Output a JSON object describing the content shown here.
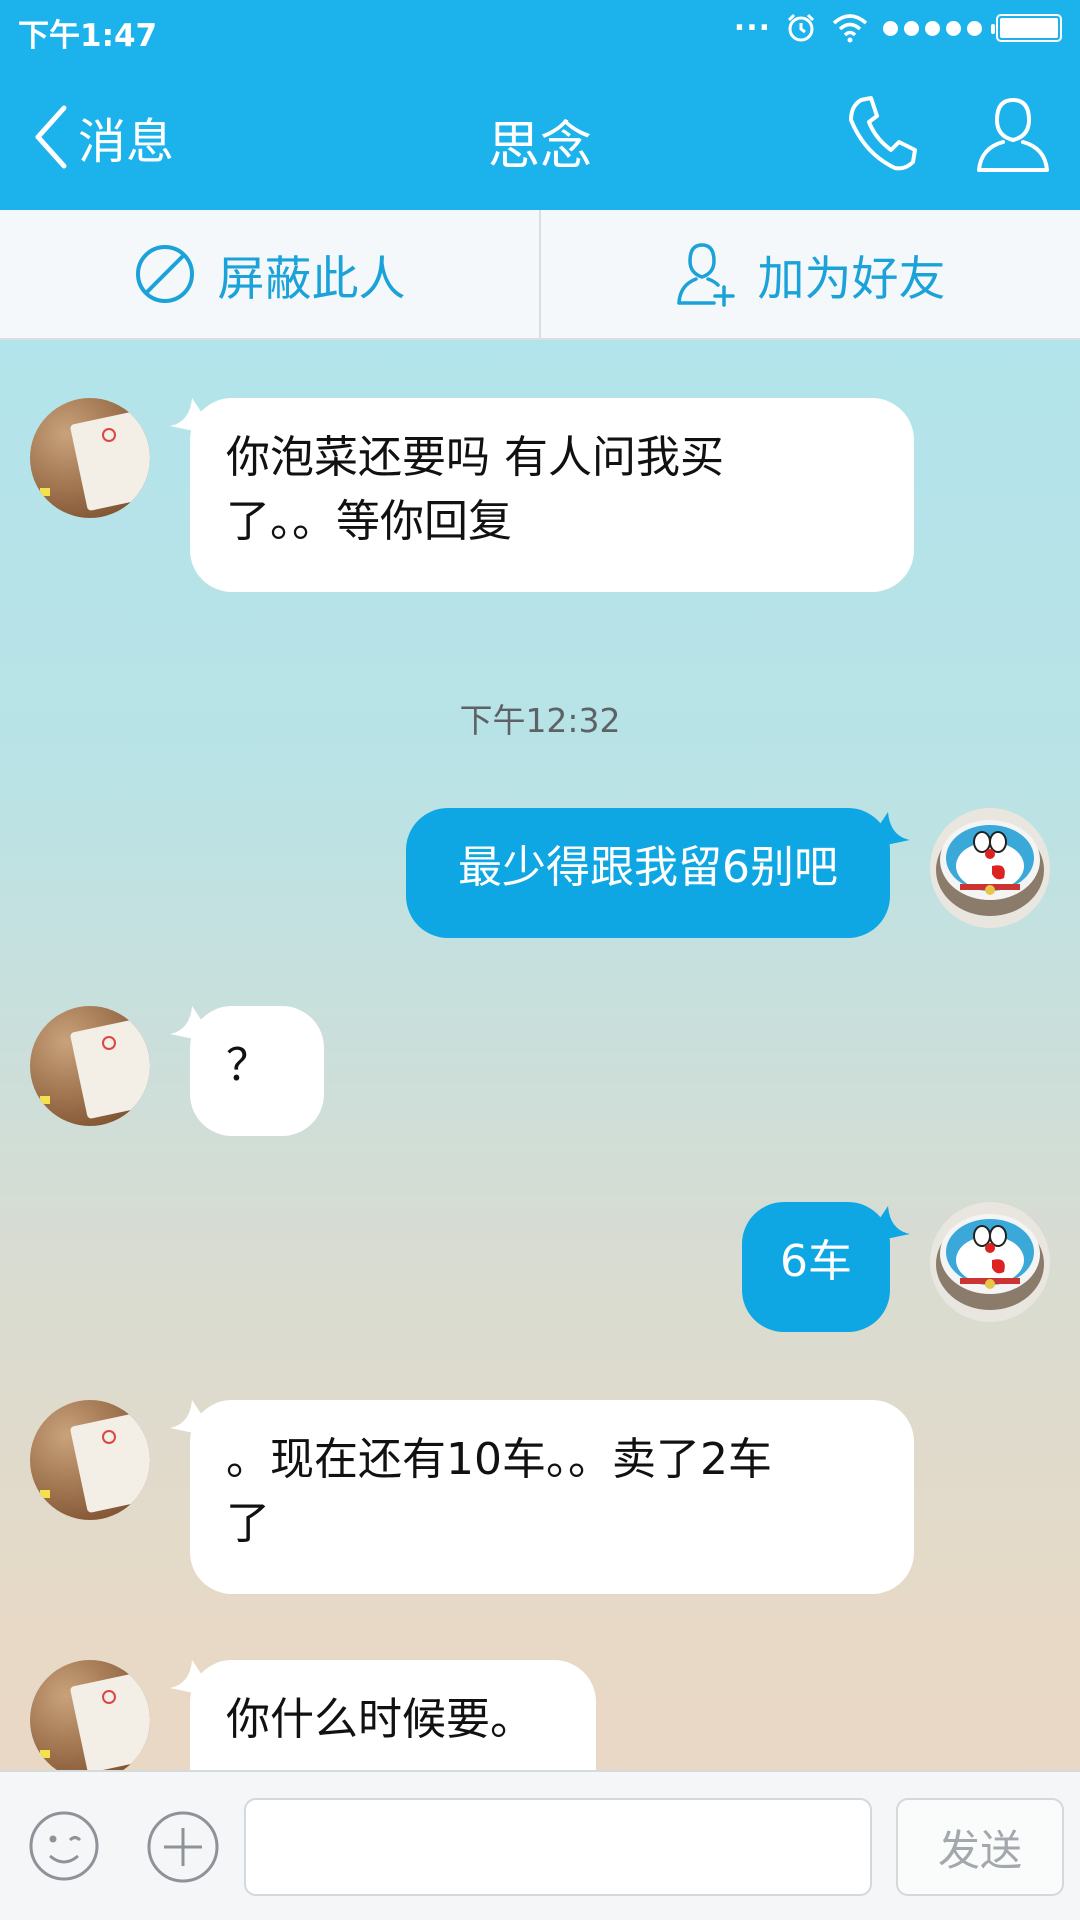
{
  "status_bar": {
    "time": "下午1:47",
    "dots": "...",
    "icons": [
      "alarm-icon",
      "wifi-icon",
      "signal-icon",
      "battery-icon"
    ]
  },
  "nav": {
    "back_label": "消息",
    "title": "思念",
    "icons": [
      "chevron-left-icon",
      "phone-icon",
      "profile-icon"
    ]
  },
  "actions": {
    "block_label": "屏蔽此人",
    "add_friend_label": "加为好友"
  },
  "messages": [
    {
      "side": "left",
      "text_lines": [
        "你泡菜还要吗 有人问我买",
        "了。。等你回复"
      ]
    },
    {
      "side": "right",
      "text_lines": [
        "最少得跟我留6别吧"
      ]
    },
    {
      "side": "left",
      "text_lines": [
        "？"
      ]
    },
    {
      "side": "right",
      "text_lines": [
        "6车"
      ]
    },
    {
      "side": "left",
      "text_lines": [
        "。现在还有10车。。卖了2车",
        "了"
      ]
    },
    {
      "side": "left",
      "text_lines": [
        "你什么时候要。"
      ]
    }
  ],
  "timestamp": "下午12:32",
  "input": {
    "placeholder": "",
    "send_label": "发送"
  },
  "colors": {
    "header": "#1cb2eb",
    "accent": "#1ba2d8",
    "own_bubble": "#0fa7e3"
  }
}
